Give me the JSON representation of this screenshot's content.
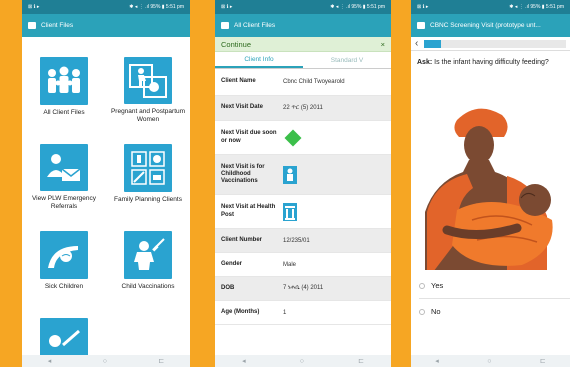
{
  "status": {
    "left": "⊠ ℹ ▸",
    "right": "✱ ◂ ⋮ .ıl 95% ▮ 5:51 pm"
  },
  "colors": {
    "teal": "#2ba2b9",
    "dark_teal": "#1f7f95",
    "tile_blue": "#2aa3d0",
    "green_diamond": "#3bbf4a",
    "background": "#f6a623"
  },
  "screen1": {
    "title": "Client Files",
    "tiles": [
      {
        "label": "All Client Files",
        "icon": "family-icon"
      },
      {
        "label": "Pregnant and Postpartum Women",
        "icon": "pregnant-woman-icon"
      },
      {
        "label": "View PLW Emergency Referrals",
        "icon": "referral-icon"
      },
      {
        "label": "Family Planning Clients",
        "icon": "family-planning-icon"
      },
      {
        "label": "Sick Children",
        "icon": "sick-child-icon"
      },
      {
        "label": "Child Vaccinations",
        "icon": "vaccination-icon"
      },
      {
        "label": "",
        "icon": "syringe-icon"
      }
    ]
  },
  "screen2": {
    "title": "All Client Files",
    "continue_label": "Continue",
    "continue_close": "×",
    "tabs": [
      "Client Info",
      "Standard V"
    ],
    "rows": [
      {
        "label": "Client Name",
        "value": "Cbnc Child Twoyearold"
      },
      {
        "label": "Next Visit Date",
        "value": "22 ጥር (5) 2011"
      },
      {
        "label": "Next Visit due soon or now",
        "value": ""
      },
      {
        "label": "Next Visit is for Childhood Vaccinations",
        "value": ""
      },
      {
        "label": "Next Visit at Health Post",
        "value": ""
      },
      {
        "label": "Client Number",
        "value": "12/235/01"
      },
      {
        "label": "Gender",
        "value": "Male"
      },
      {
        "label": "DOB",
        "value": "7 ነሐሴ (4) 2011"
      },
      {
        "label": "Age (Months)",
        "value": "1"
      }
    ]
  },
  "screen3": {
    "title": "CBNC Screening Visit (prototype unt...",
    "back": "‹",
    "progress": 0.12,
    "question_prefix": "Ask:",
    "question": " Is the infant having difficulty feeding?",
    "answers": [
      "Yes",
      "No"
    ]
  },
  "nav": {
    "back": "◂",
    "home": "○",
    "recents": "⊏"
  }
}
